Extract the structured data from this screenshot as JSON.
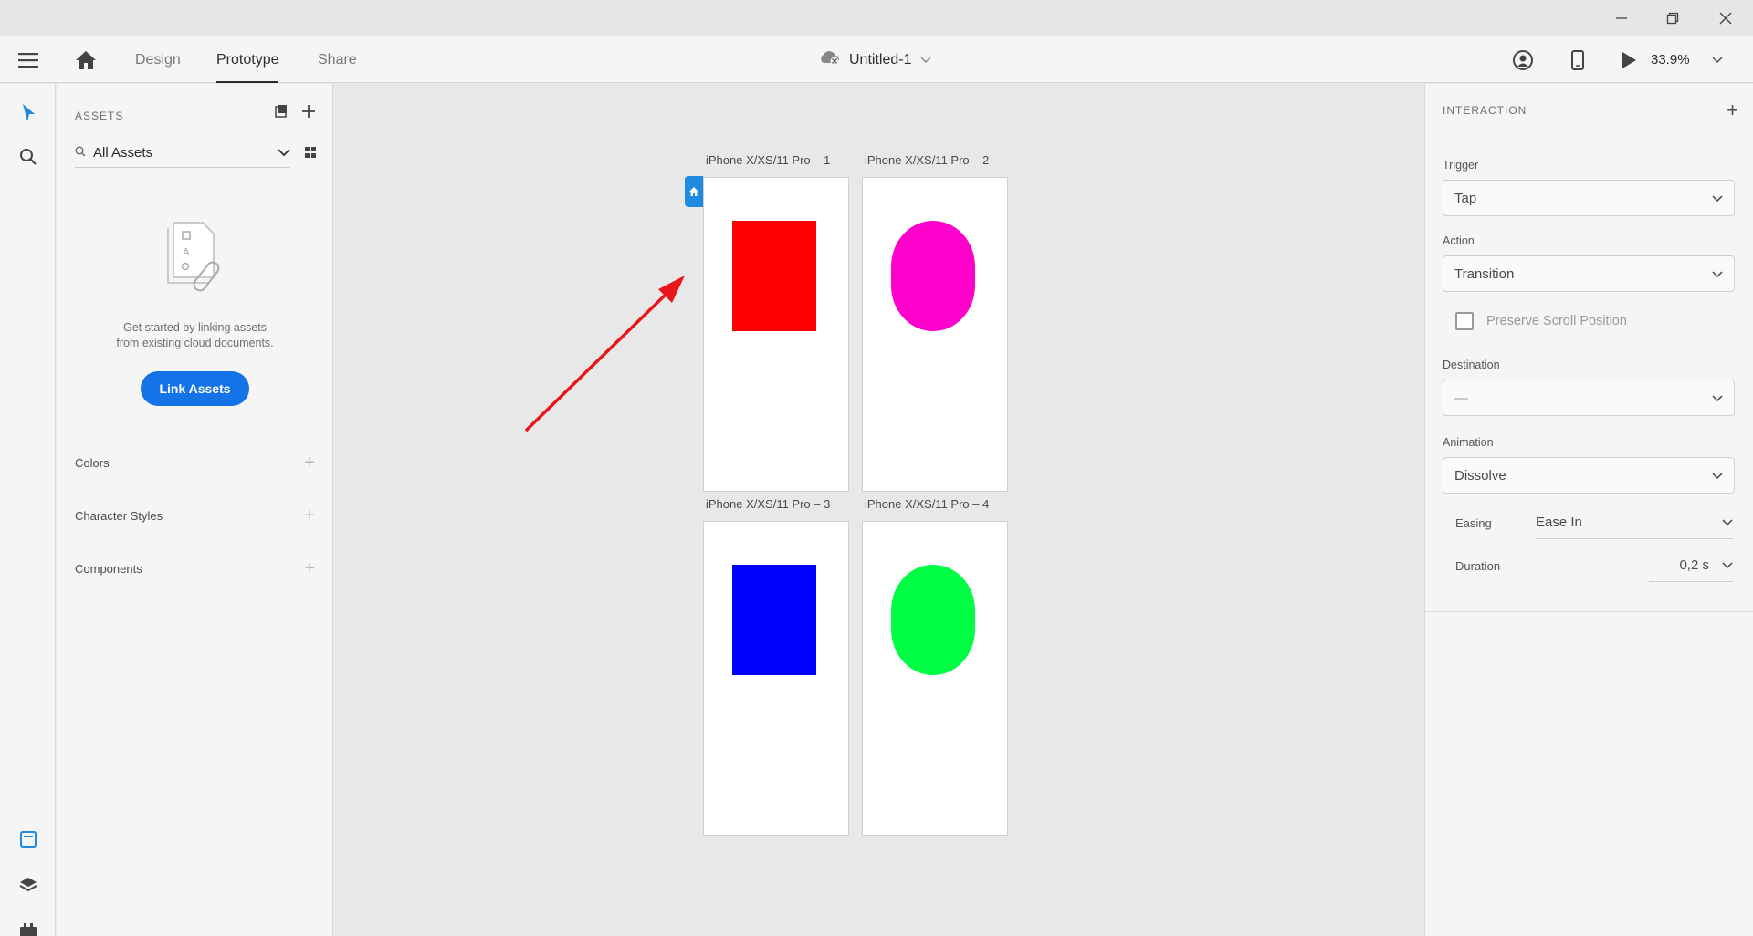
{
  "app": {
    "tabs": [
      {
        "label": "Design",
        "active": false
      },
      {
        "label": "Prototype",
        "active": true
      },
      {
        "label": "Share",
        "active": false
      }
    ],
    "document_title": "Untitled-1",
    "zoom": "33.9%"
  },
  "assets": {
    "header": "ASSETS",
    "filter_value": "All Assets",
    "empty_message_line1": "Get started by linking assets",
    "empty_message_line2": "from existing cloud documents.",
    "link_button": "Link Assets",
    "sections": [
      {
        "label": "Colors"
      },
      {
        "label": "Character Styles"
      },
      {
        "label": "Components"
      }
    ]
  },
  "canvas": {
    "artboards": [
      {
        "label": "iPhone X/XS/11 Pro – 1",
        "shape": "rect",
        "color": "#ff0000"
      },
      {
        "label": "iPhone X/XS/11 Pro – 2",
        "shape": "pill",
        "color": "#ff00cc"
      },
      {
        "label": "iPhone X/XS/11 Pro – 3",
        "shape": "rect",
        "color": "#0000ff"
      },
      {
        "label": "iPhone X/XS/11 Pro – 4",
        "shape": "pill",
        "color": "#00ff44"
      }
    ],
    "annotation_arrow_color": "#e8161a"
  },
  "interaction": {
    "header": "INTERACTION",
    "trigger_label": "Trigger",
    "trigger_value": "Tap",
    "action_label": "Action",
    "action_value": "Transition",
    "preserve_scroll_label": "Preserve Scroll Position",
    "destination_label": "Destination",
    "destination_value": "—",
    "animation_label": "Animation",
    "animation_value": "Dissolve",
    "easing_label": "Easing",
    "easing_value": "Ease In",
    "duration_label": "Duration",
    "duration_value": "0,2 s"
  },
  "colors": {
    "accent": "#1473e6",
    "home_badge": "#1e8be0"
  }
}
